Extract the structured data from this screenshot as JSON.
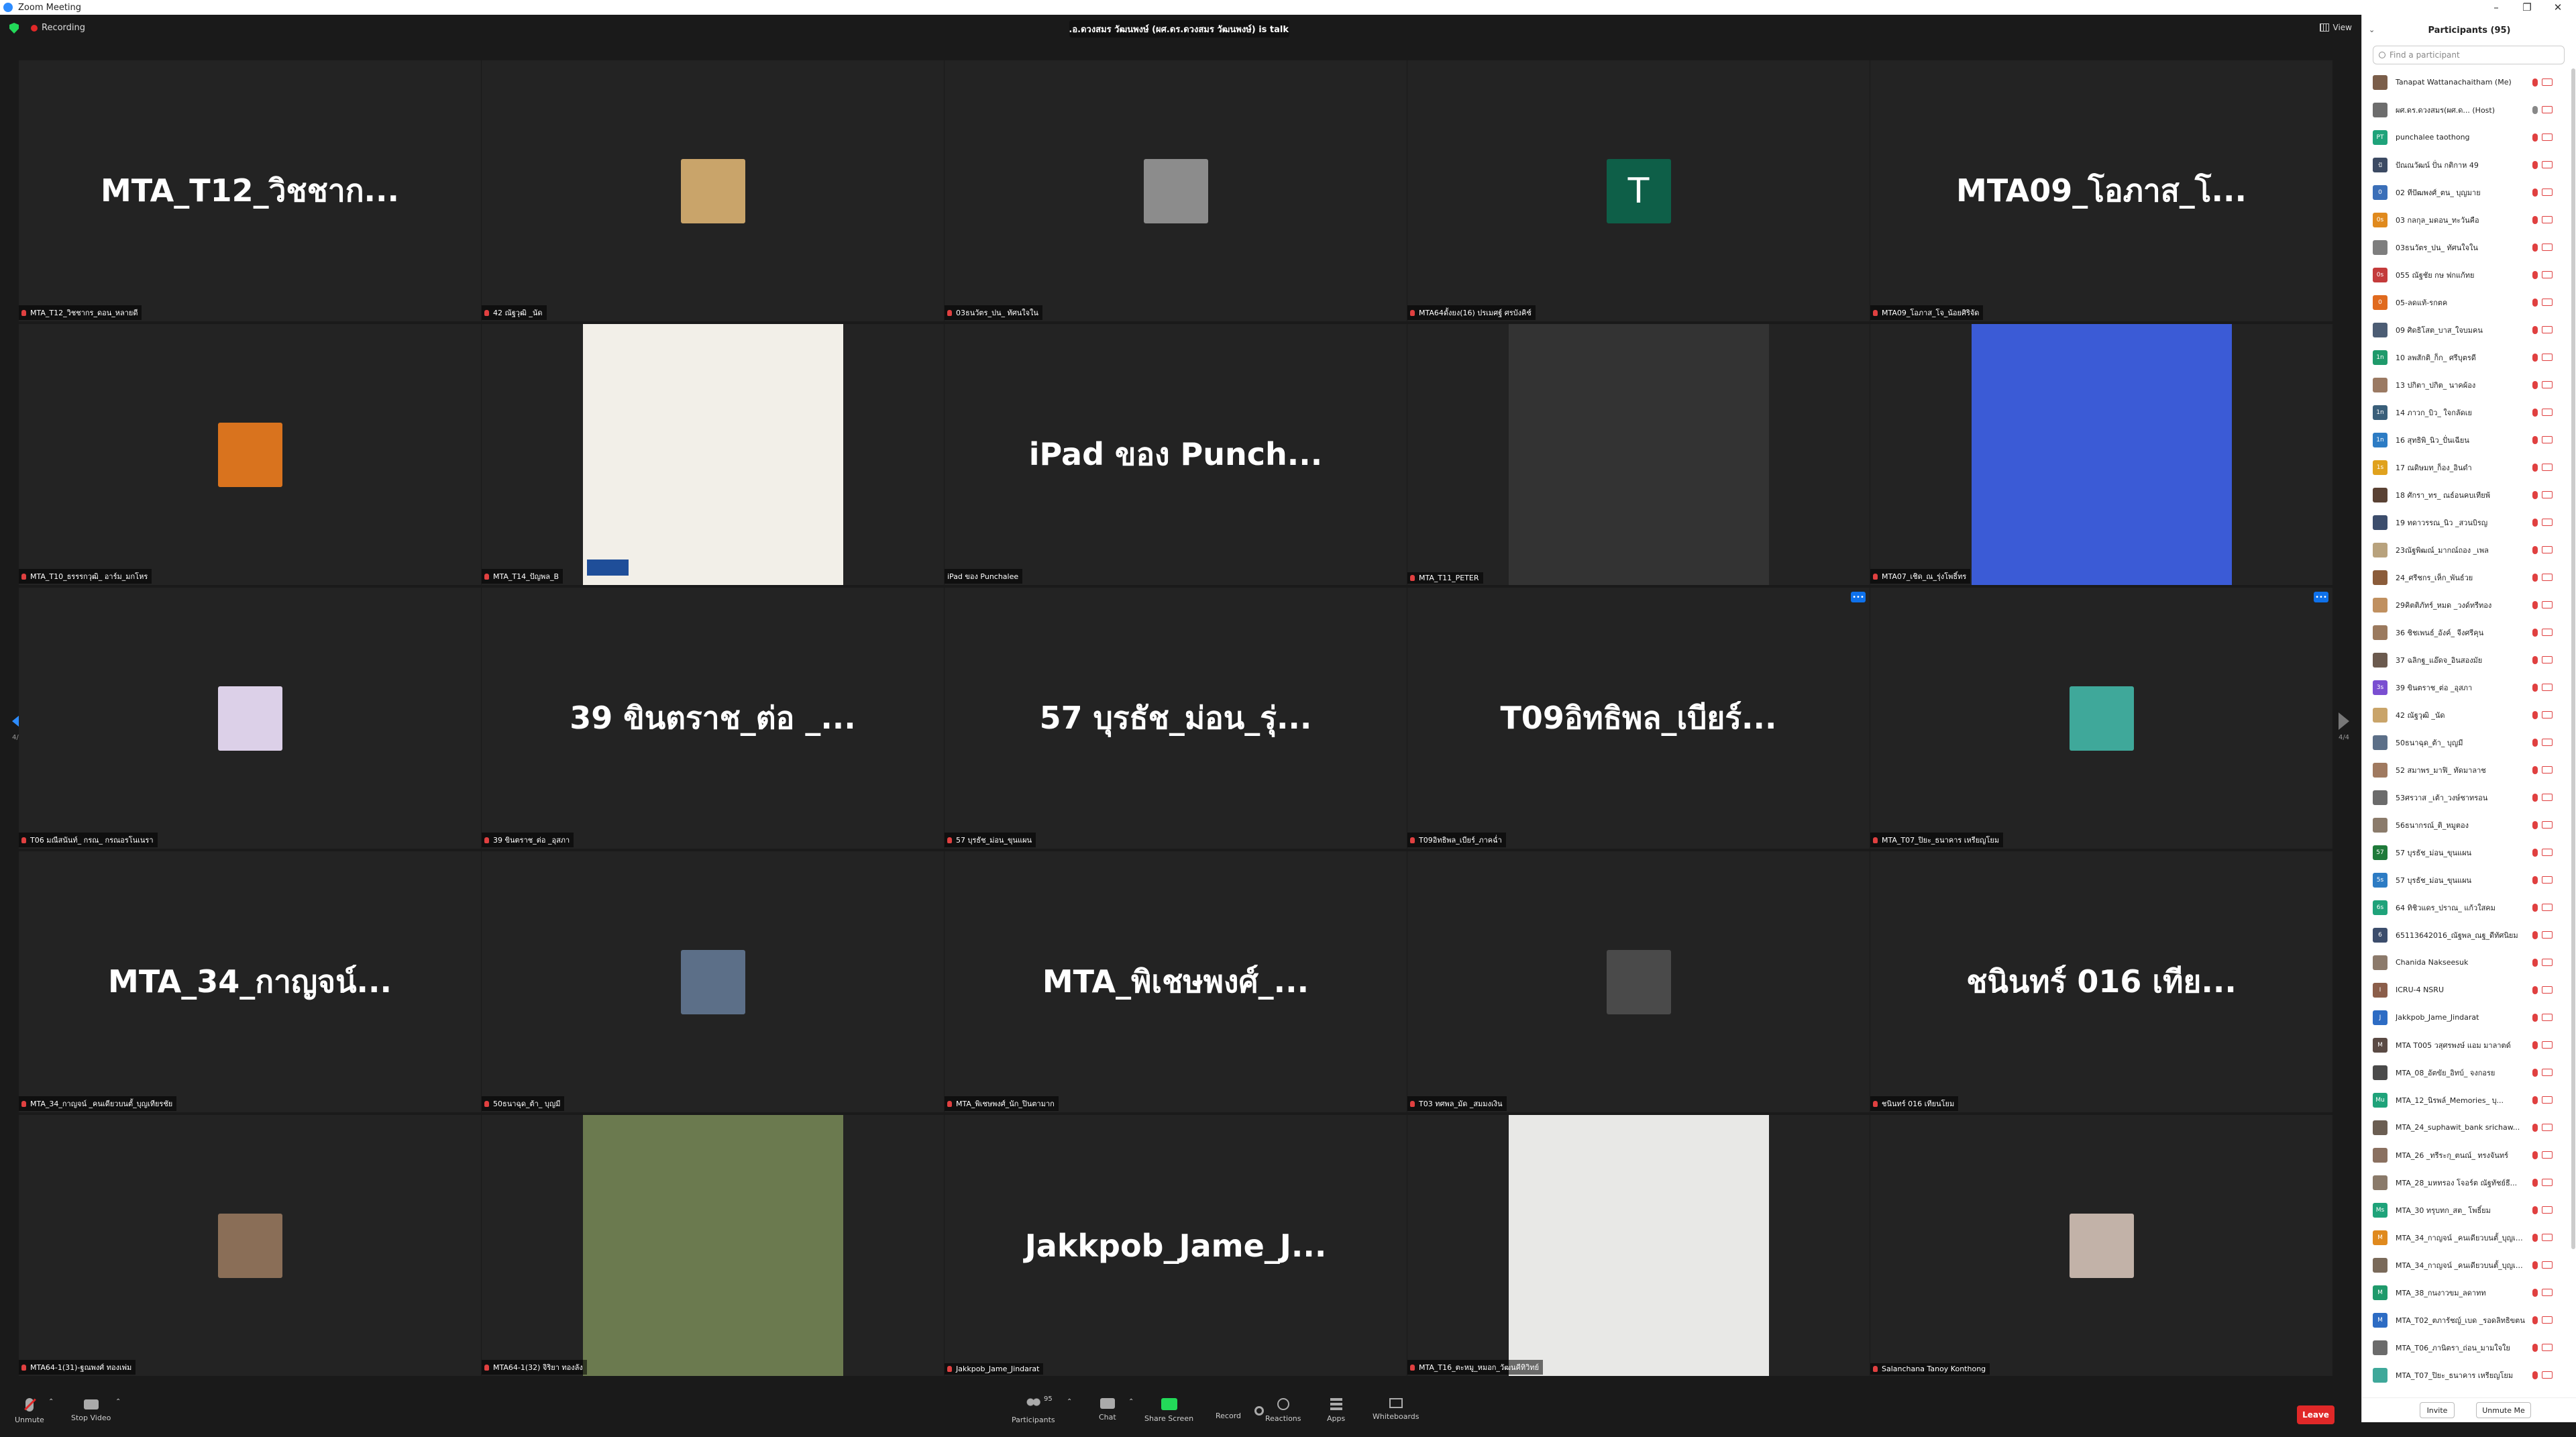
{
  "window": {
    "title": "Zoom Meeting"
  },
  "topbar": {
    "recording": "Recording",
    "talking": "ผศ.ดร.อ.ดวงสมร วัฒนพงษ์ (ผศ.ดร.ดวงสมร วัฒนพงษ์) is talking...",
    "view": "View"
  },
  "nav": {
    "page_left": "4/4",
    "page_right": "4/4"
  },
  "tiles": [
    {
      "big": "MTA_T12_วิชชาก...",
      "label": "MTA_T12_วิชชากร_ดอน_หลายดี",
      "kind": "name"
    },
    {
      "big": "",
      "label": "42 ณัฐวุฒิ _นัด",
      "kind": "pic",
      "color": "#c9a46a"
    },
    {
      "big": "",
      "label": "03ธนวัตร_ปน_ ทัศนใจใน",
      "kind": "pic",
      "color": "#8c8c8c"
    },
    {
      "big": "T",
      "label": "MTA64ดั้งยง(16) ปรเมศฐ์ ศรบังคิช์",
      "kind": "letter"
    },
    {
      "big": "MTA09_โอภาส_โ...",
      "label": "MTA09_โอภาส_โจ_น้อยศิริจัด",
      "kind": "name"
    },
    {
      "big": "",
      "label": "MTA_T10_ธรรรกวุฒิ_ อาร์ม_มกโหร",
      "kind": "pic",
      "color": "#d9731e"
    },
    {
      "big": "",
      "label": "MTA_T14_ปัญพล_B",
      "kind": "doc"
    },
    {
      "big": "iPad ของ Punch...",
      "label": "iPad ของ Punchalee",
      "kind": "name"
    },
    {
      "big": "",
      "label": "MTA_T11_PETER",
      "kind": "video",
      "color": "#333"
    },
    {
      "big": "",
      "label": "MTA07_เชิด_ณ_รุ่งโพธิ์ทร",
      "kind": "video",
      "color": "#3b5bd6"
    },
    {
      "big": "",
      "label": "T06 มณีสนันท์_ กรณ_ กรณอรโนเนรา",
      "kind": "pic",
      "color": "#dcd0e8"
    },
    {
      "big": "39 ขินตราช_ต่อ _...",
      "label": "39 ขินตราช_ต่อ _อุสภา",
      "kind": "name"
    },
    {
      "big": "57 บุรธัช_ม่อน_รุ่...",
      "label": "57 บุรธัช_ม่อน_ขุนแผน",
      "kind": "name"
    },
    {
      "big": "T09อิทธิพล_เบียร์...",
      "label": "T09อิทธิพล_เบียร์_ภาคฉ่ำ",
      "kind": "name"
    },
    {
      "big": "",
      "label": "MTA_T07_ปิยะ_ธนาคาร เหรียญโยม",
      "kind": "pic",
      "color": "#3fa89a"
    },
    {
      "big": "MTA_34_กาญจน์...",
      "label": "MTA_34_กาญจน์ _คนเดียวบนตั้_บุญเทียรชัย",
      "kind": "name"
    },
    {
      "big": "",
      "label": "50ธนาฉุด_ต้า_ บุญมี",
      "kind": "pic",
      "color": "#5c6f88"
    },
    {
      "big": "MTA_พิเชษพงศ์_...",
      "label": "MTA_พิเชษพงศ์_นัก_ปินตามาก",
      "kind": "name"
    },
    {
      "big": "",
      "label": "T03 ทศพล_มัด _สมมงเงิน",
      "kind": "pic",
      "color": "#4a4a4a"
    },
    {
      "big": "ชนินทร์ 016 เทีย...",
      "label": "ชนินทร์ 016 เทียนโยม",
      "kind": "name"
    },
    {
      "big": "",
      "label": "MTA64-1(31)-ฐณพงศ์ ทองเพ่ม",
      "kind": "pic",
      "color": "#8a6e57"
    },
    {
      "big": "",
      "label": "MTA64-1(32) จิริยา ทองลัง",
      "kind": "video",
      "color": "#6b7a4f"
    },
    {
      "big": "Jakkpob_Jame_J...",
      "label": "Jakkpob_Jame_Jindarat",
      "kind": "name"
    },
    {
      "big": "",
      "label": "MTA_T16_ตะหมู_หมอก_วัฒนคีทิวิทย์",
      "kind": "video",
      "color": "#e8e8e6"
    },
    {
      "big": "",
      "label": "Salanchana Tanoy Konthong",
      "kind": "pic",
      "color": "#c2b2a8"
    }
  ],
  "toolbar": {
    "unmute": "Unmute",
    "stop_video": "Stop Video",
    "participants": "Participants",
    "participants_count": "95",
    "chat": "Chat",
    "share": "Share Screen",
    "record": "Record",
    "reactions": "Reactions",
    "apps": "Apps",
    "whiteboards": "Whiteboards",
    "leave": "Leave"
  },
  "panel": {
    "title": "Participants (95)",
    "search_placeholder": "Find a participant",
    "invite": "Invite",
    "unmute_me": "Unmute Me",
    "participants": [
      {
        "name": "Tanapat Wattanachaitham (Me)",
        "initials": "",
        "color": "#7b5e4a",
        "mic": false,
        "cam": false
      },
      {
        "name": "ผศ.ดร.ดวงสมร(ผศ.ด... (Host)",
        "initials": "",
        "color": "#6d6d6d",
        "mic": true,
        "cam": false
      },
      {
        "name": "punchalee taothong",
        "initials": "PT",
        "color": "#1fa37a",
        "mic": false,
        "cam": false
      },
      {
        "name": "ปัณณวัฒน์ ปั่น กติกาห 49",
        "initials": "ปั",
        "color": "#3c4a63",
        "mic": false,
        "cam": false
      },
      {
        "name": "02 ทีปัฒพงศ์_ตน_ บุญมาย",
        "initials": "0",
        "color": "#3b6fb8",
        "mic": false,
        "cam": false
      },
      {
        "name": "03 กลกุล_มดอน_ทะวันคือ",
        "initials": "0s",
        "color": "#e08a1e",
        "mic": false,
        "cam": false
      },
      {
        "name": "03ธนวัตร_ปน_ ทัศนใจใน",
        "initials": "",
        "color": "#7e7e7e",
        "mic": false,
        "cam": false
      },
      {
        "name": "055 ณัฐชัย กษ ฟกแก้ทย",
        "initials": "0s",
        "color": "#c43b3b",
        "mic": false,
        "cam": false
      },
      {
        "name": "05-ลดแท้-รกตค",
        "initials": "0",
        "color": "#e06a1e",
        "mic": false,
        "cam": false
      },
      {
        "name": "09 ศิดธิโสต_บาส_ใจบมคน",
        "initials": "",
        "color": "#4c5d74",
        "mic": false,
        "cam": false
      },
      {
        "name": "10 ลพสักติ_ก็ก_ ศรีบุตรดี",
        "initials": "1n",
        "color": "#1f9a6b",
        "mic": false,
        "cam": false
      },
      {
        "name": "13 ปกิตา_ปกิต_ นาคผ้อง",
        "initials": "",
        "color": "#9b7a63",
        "mic": false,
        "cam": false
      },
      {
        "name": "14 ภาวก_บิว_ ใจกลัดเย",
        "initials": "1n",
        "color": "#3a5f7a",
        "mic": false,
        "cam": false
      },
      {
        "name": "16 สุทธิพิ_นิว_ปั่นเฉียน",
        "initials": "1n",
        "color": "#2d7cc4",
        "mic": false,
        "cam": false
      },
      {
        "name": "17 ณดิษมท_ก็อง_อินดำ",
        "initials": "1s",
        "color": "#e0a21e",
        "mic": false,
        "cam": false
      },
      {
        "name": "18 ศักรา_ทร_ ณธ์อนคบเทียพ้",
        "initials": "",
        "color": "#5a4234",
        "mic": false,
        "cam": false
      },
      {
        "name": "19 ทดาวรรณ_นิว _สวนบิรญ",
        "initials": "",
        "color": "#3c4d6c",
        "mic": false,
        "cam": false
      },
      {
        "name": "23ณัฐพิฒณ์_มากณ์ถอง _เพล",
        "initials": "",
        "color": "#b8a27d",
        "mic": false,
        "cam": false
      },
      {
        "name": "24_ศรีชกร_เห็ก_พันธ์วย",
        "initials": "",
        "color": "#8b5c3a",
        "mic": false,
        "cam": false
      },
      {
        "name": "29คิตติภัทร์_หมด _วงด์ทรีทอง",
        "initials": "",
        "color": "#c09060",
        "mic": false,
        "cam": false
      },
      {
        "name": "36 ชิชเพนธ์_อังค์_ จีงศรีคุน",
        "initials": "",
        "color": "#9b7a5e",
        "mic": false,
        "cam": false
      },
      {
        "name": "37 ฉลิกฐ_แอ๊ดจ_อินสองมัย",
        "initials": "",
        "color": "#6b5a4e",
        "mic": false,
        "cam": false
      },
      {
        "name": "39 ขินตราช_ต่อ _อุสภา",
        "initials": "3s",
        "color": "#7a4fd1",
        "mic": false,
        "cam": false
      },
      {
        "name": "42 ณัฐวุฒิ _นัด",
        "initials": "",
        "color": "#c9a46a",
        "mic": false,
        "cam": false
      },
      {
        "name": "50ธนาฉุด_ต้า_ บุญมี",
        "initials": "",
        "color": "#5c6f88",
        "mic": false,
        "cam": false
      },
      {
        "name": "52 สมาพร_มาฟิ_ ทัดมาลาช",
        "initials": "",
        "color": "#a07a60",
        "mic": false,
        "cam": false
      },
      {
        "name": "53ศรวาส _เต้า_วงษ์ชาทรอน",
        "initials": "",
        "color": "#6b6b6b",
        "mic": false,
        "cam": false
      },
      {
        "name": "56ธนากรณ์_ติ_หมูตอง",
        "initials": "",
        "color": "#8b7b6b",
        "mic": false,
        "cam": false
      },
      {
        "name": "57 บุรธัช_ม่อน_ขุนแผน",
        "initials": "57",
        "color": "#1f7a3a",
        "mic": false,
        "cam": false
      },
      {
        "name": "57 บุรธัช_ม่อน_ขุนแผน",
        "initials": "5s",
        "color": "#2d7cc4",
        "mic": false,
        "cam": false
      },
      {
        "name": "64 ทิชิวแดร_ปราณ_ แก้วใสคม",
        "initials": "6s",
        "color": "#1fa37a",
        "mic": false,
        "cam": false
      },
      {
        "name": "65113642016_ณัฐพล_ณฐ_ดีทัศนิยม",
        "initials": "6",
        "color": "#3c4d6c",
        "mic": false,
        "cam": false
      },
      {
        "name": "Chanida Nakseesuk",
        "initials": "",
        "color": "#8c7a6b",
        "mic": false,
        "cam": false
      },
      {
        "name": "ICRU-4 NSRU",
        "initials": "I",
        "color": "#8b5e4a",
        "mic": false,
        "cam": false
      },
      {
        "name": "Jakkpob_Jame_Jindarat",
        "initials": "J",
        "color": "#2d6cc4",
        "mic": false,
        "cam": false
      },
      {
        "name": "MTA T005 วสุศรพงษ์ แอม มาลาตด์",
        "initials": "M",
        "color": "#5a4a44",
        "mic": false,
        "cam": false
      },
      {
        "name": "MTA_08_อัตขัย_อิทบ์_ จงกอรย",
        "initials": "",
        "color": "#4a4a4a",
        "mic": false,
        "cam": false
      },
      {
        "name": "MTA_12_นิรพล์_Memories_ บุ...",
        "initials": "Mu",
        "color": "#1fa37a",
        "mic": false,
        "cam": false
      },
      {
        "name": "MTA_24_suphawit_bank srichaw...",
        "initials": "",
        "color": "#6b5e52",
        "mic": false,
        "cam": false
      },
      {
        "name": "MTA_26 _ทรีระกุ_ตนณ์_ ทรงจันทร์",
        "initials": "",
        "color": "#8a7060",
        "mic": false,
        "cam": false
      },
      {
        "name": "MTA_28_มหทรอง โจอร์ต ณัฐทัชย์ธี...",
        "initials": "",
        "color": "#8a7a6a",
        "mic": false,
        "cam": false
      },
      {
        "name": "MTA_30 ทรุบทก_สต_ โพธิ์ยม",
        "initials": "Ms",
        "color": "#1fa37a",
        "mic": false,
        "cam": false
      },
      {
        "name": "MTA_34_กาญจน์ _คนเดียวบนตั้_บุญเทียรชัย",
        "initials": "M",
        "color": "#e08a1e",
        "mic": false,
        "cam": false
      },
      {
        "name": "MTA_34_กาญจน์ _คนเดียวบนตั้_บุญเทียรชัย",
        "initials": "",
        "color": "#7a6a5a",
        "mic": false,
        "cam": false
      },
      {
        "name": "MTA_38_กนงาวขม_ลดาทท",
        "initials": "M",
        "color": "#1f9a6b",
        "mic": false,
        "cam": false
      },
      {
        "name": "MTA_T02_ตภารัชญ์_เบด _รอดลิทธิขตน",
        "initials": "M",
        "color": "#2d6cc4",
        "mic": false,
        "cam": false
      },
      {
        "name": "MTA_T06_ภานิตรา_ถ่อน_มามใจใย",
        "initials": "",
        "color": "#6b6b6b",
        "mic": false,
        "cam": false
      },
      {
        "name": "MTA_T07_ปิยะ_ธนาคาร เหรียญโยม",
        "initials": "",
        "color": "#3fa89a",
        "mic": false,
        "cam": false
      }
    ]
  }
}
